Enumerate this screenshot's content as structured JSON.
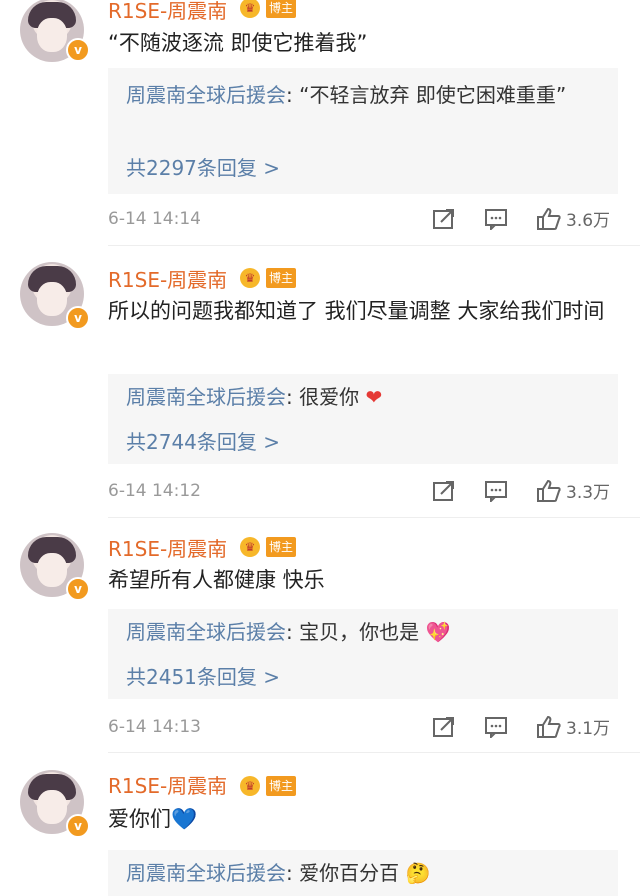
{
  "comments": [
    {
      "author": "R1SE-周震南",
      "badge": "博主",
      "text": "“不随波逐流 即使它推着我”",
      "reply": {
        "author": "周震南全球后援会",
        "sep": ": ",
        "text": "“不轻言放弃 即使它困难重重”",
        "emoji": "",
        "count": "共2297条回复 >"
      },
      "time": "6-14 14:14",
      "likes": "3.6万"
    },
    {
      "author": "R1SE-周震南",
      "badge": "博主",
      "text": "所以的问题我都知道了 我们尽量调整 大家给我们时间",
      "reply": {
        "author": "周震南全球后援会",
        "sep": ": ",
        "text": "很爱你",
        "emoji": "❤",
        "count": "共2744条回复 >"
      },
      "time": "6-14 14:12",
      "likes": "3.3万"
    },
    {
      "author": "R1SE-周震南",
      "badge": "博主",
      "text": "希望所有人都健康 快乐",
      "reply": {
        "author": "周震南全球后援会",
        "sep": ": ",
        "text": "宝贝，你也是",
        "emoji": "💖",
        "count": "共2451条回复 >"
      },
      "time": "6-14 14:13",
      "likes": "3.1万"
    },
    {
      "author": "R1SE-周震南",
      "badge": "博主",
      "text": "爱你们",
      "text_emoji": "💙",
      "reply": {
        "author": "周震南全球后援会",
        "sep": ": ",
        "text": "爱你百分百",
        "emoji": "🤔"
      }
    }
  ],
  "icons": {
    "share": "share-icon",
    "comment": "comment-icon",
    "like": "like-icon",
    "verified": "verified-badge-icon",
    "crown": "crown-icon"
  },
  "colors": {
    "author": "#e36a2a",
    "reply_author": "#5b7fa8",
    "badge": "#f29a1f",
    "meta": "#999999"
  }
}
